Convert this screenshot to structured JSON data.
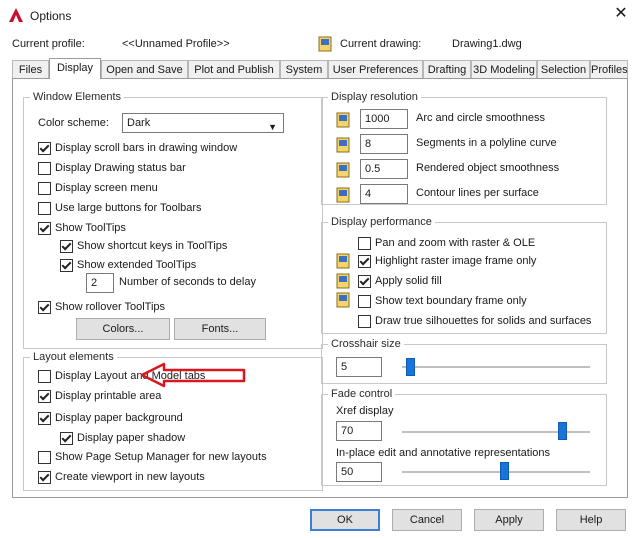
{
  "window": {
    "title": "Options",
    "close_glyph": "✕"
  },
  "profile": {
    "current_profile_label": "Current profile:",
    "current_profile_value": "<<Unnamed Profile>>",
    "current_drawing_label": "Current drawing:",
    "current_drawing_value": "Drawing1.dwg"
  },
  "tabs": [
    {
      "label": "Files"
    },
    {
      "label": "Display"
    },
    {
      "label": "Open and Save"
    },
    {
      "label": "Plot and Publish"
    },
    {
      "label": "System"
    },
    {
      "label": "User Preferences"
    },
    {
      "label": "Drafting"
    },
    {
      "label": "3D Modeling"
    },
    {
      "label": "Selection"
    },
    {
      "label": "Profiles"
    }
  ],
  "window_elements": {
    "title": "Window Elements",
    "color_scheme_label": "Color scheme:",
    "color_scheme_value": "Dark",
    "items": [
      {
        "label": "Display scroll bars in drawing window",
        "checked": true
      },
      {
        "label": "Display Drawing status bar",
        "checked": false
      },
      {
        "label": "Display screen menu",
        "checked": false
      },
      {
        "label": "Use large buttons for Toolbars",
        "checked": false
      },
      {
        "label": "Show ToolTips",
        "checked": true
      },
      {
        "label": "Show shortcut keys in ToolTips",
        "checked": true
      },
      {
        "label": "Show extended ToolTips",
        "checked": true
      },
      {
        "label": "Show rollover ToolTips",
        "checked": true
      }
    ],
    "delay_value": "2",
    "delay_label": "Number of seconds to delay",
    "colors_button": "Colors...",
    "fonts_button": "Fonts..."
  },
  "layout_elements": {
    "title": "Layout elements",
    "items": [
      {
        "label": "Display Layout and Model tabs",
        "checked": false
      },
      {
        "label": "Display printable area",
        "checked": true
      },
      {
        "label": "Display paper background",
        "checked": true
      },
      {
        "label": "Display paper shadow",
        "checked": true
      },
      {
        "label": "Show Page Setup Manager for new layouts",
        "checked": false
      },
      {
        "label": "Create viewport in new layouts",
        "checked": true
      }
    ]
  },
  "display_resolution": {
    "title": "Display resolution",
    "items": [
      {
        "value": "1000",
        "label": "Arc and circle smoothness"
      },
      {
        "value": "8",
        "label": "Segments in a polyline curve"
      },
      {
        "value": "0.5",
        "label": "Rendered object smoothness"
      },
      {
        "value": "4",
        "label": "Contour lines per surface"
      }
    ]
  },
  "display_performance": {
    "title": "Display performance",
    "items": [
      {
        "label": "Pan and zoom with raster & OLE",
        "checked": false
      },
      {
        "label": "Highlight raster image frame only",
        "checked": true
      },
      {
        "label": "Apply solid fill",
        "checked": true
      },
      {
        "label": "Show text boundary frame only",
        "checked": false
      },
      {
        "label": "Draw true silhouettes for solids and surfaces",
        "checked": false
      }
    ]
  },
  "crosshair": {
    "title": "Crosshair size",
    "value": "5",
    "level": 0.05
  },
  "fade_control": {
    "title": "Fade control",
    "xref_label": "Xref display",
    "xref_value": "70",
    "xref_level": 0.7,
    "inplace_label": "In-place edit and annotative representations",
    "inplace_value": "50",
    "inplace_level": 0.5
  },
  "buttons": {
    "ok": "OK",
    "cancel": "Cancel",
    "apply": "Apply",
    "help": "Help"
  },
  "colors": {
    "annotation_red": "#d9171e",
    "slider_blue": "#1a73d9",
    "focus_blue": "#3c7fd6"
  },
  "icons": {
    "app": "autocad-a-icon",
    "drawing": "drawing-file-icon"
  }
}
